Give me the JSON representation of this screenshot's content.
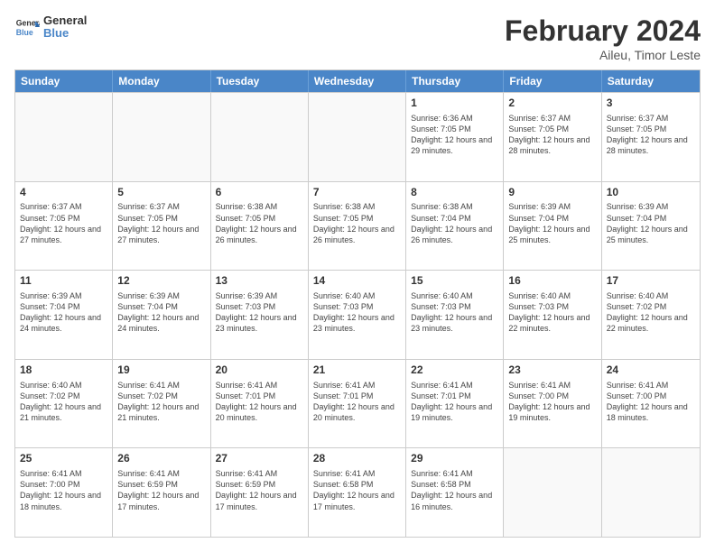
{
  "logo": {
    "general": "General",
    "blue": "Blue"
  },
  "header": {
    "title": "February 2024",
    "subtitle": "Aileu, Timor Leste"
  },
  "weekdays": [
    "Sunday",
    "Monday",
    "Tuesday",
    "Wednesday",
    "Thursday",
    "Friday",
    "Saturday"
  ],
  "weeks": [
    [
      {
        "day": "",
        "info": "",
        "empty": true
      },
      {
        "day": "",
        "info": "",
        "empty": true
      },
      {
        "day": "",
        "info": "",
        "empty": true
      },
      {
        "day": "",
        "info": "",
        "empty": true
      },
      {
        "day": "1",
        "info": "Sunrise: 6:36 AM\nSunset: 7:05 PM\nDaylight: 12 hours and 29 minutes."
      },
      {
        "day": "2",
        "info": "Sunrise: 6:37 AM\nSunset: 7:05 PM\nDaylight: 12 hours and 28 minutes."
      },
      {
        "day": "3",
        "info": "Sunrise: 6:37 AM\nSunset: 7:05 PM\nDaylight: 12 hours and 28 minutes."
      }
    ],
    [
      {
        "day": "4",
        "info": "Sunrise: 6:37 AM\nSunset: 7:05 PM\nDaylight: 12 hours and 27 minutes."
      },
      {
        "day": "5",
        "info": "Sunrise: 6:37 AM\nSunset: 7:05 PM\nDaylight: 12 hours and 27 minutes."
      },
      {
        "day": "6",
        "info": "Sunrise: 6:38 AM\nSunset: 7:05 PM\nDaylight: 12 hours and 26 minutes."
      },
      {
        "day": "7",
        "info": "Sunrise: 6:38 AM\nSunset: 7:05 PM\nDaylight: 12 hours and 26 minutes."
      },
      {
        "day": "8",
        "info": "Sunrise: 6:38 AM\nSunset: 7:04 PM\nDaylight: 12 hours and 26 minutes."
      },
      {
        "day": "9",
        "info": "Sunrise: 6:39 AM\nSunset: 7:04 PM\nDaylight: 12 hours and 25 minutes."
      },
      {
        "day": "10",
        "info": "Sunrise: 6:39 AM\nSunset: 7:04 PM\nDaylight: 12 hours and 25 minutes."
      }
    ],
    [
      {
        "day": "11",
        "info": "Sunrise: 6:39 AM\nSunset: 7:04 PM\nDaylight: 12 hours and 24 minutes."
      },
      {
        "day": "12",
        "info": "Sunrise: 6:39 AM\nSunset: 7:04 PM\nDaylight: 12 hours and 24 minutes."
      },
      {
        "day": "13",
        "info": "Sunrise: 6:39 AM\nSunset: 7:03 PM\nDaylight: 12 hours and 23 minutes."
      },
      {
        "day": "14",
        "info": "Sunrise: 6:40 AM\nSunset: 7:03 PM\nDaylight: 12 hours and 23 minutes."
      },
      {
        "day": "15",
        "info": "Sunrise: 6:40 AM\nSunset: 7:03 PM\nDaylight: 12 hours and 23 minutes."
      },
      {
        "day": "16",
        "info": "Sunrise: 6:40 AM\nSunset: 7:03 PM\nDaylight: 12 hours and 22 minutes."
      },
      {
        "day": "17",
        "info": "Sunrise: 6:40 AM\nSunset: 7:02 PM\nDaylight: 12 hours and 22 minutes."
      }
    ],
    [
      {
        "day": "18",
        "info": "Sunrise: 6:40 AM\nSunset: 7:02 PM\nDaylight: 12 hours and 21 minutes."
      },
      {
        "day": "19",
        "info": "Sunrise: 6:41 AM\nSunset: 7:02 PM\nDaylight: 12 hours and 21 minutes."
      },
      {
        "day": "20",
        "info": "Sunrise: 6:41 AM\nSunset: 7:01 PM\nDaylight: 12 hours and 20 minutes."
      },
      {
        "day": "21",
        "info": "Sunrise: 6:41 AM\nSunset: 7:01 PM\nDaylight: 12 hours and 20 minutes."
      },
      {
        "day": "22",
        "info": "Sunrise: 6:41 AM\nSunset: 7:01 PM\nDaylight: 12 hours and 19 minutes."
      },
      {
        "day": "23",
        "info": "Sunrise: 6:41 AM\nSunset: 7:00 PM\nDaylight: 12 hours and 19 minutes."
      },
      {
        "day": "24",
        "info": "Sunrise: 6:41 AM\nSunset: 7:00 PM\nDaylight: 12 hours and 18 minutes."
      }
    ],
    [
      {
        "day": "25",
        "info": "Sunrise: 6:41 AM\nSunset: 7:00 PM\nDaylight: 12 hours and 18 minutes."
      },
      {
        "day": "26",
        "info": "Sunrise: 6:41 AM\nSunset: 6:59 PM\nDaylight: 12 hours and 17 minutes."
      },
      {
        "day": "27",
        "info": "Sunrise: 6:41 AM\nSunset: 6:59 PM\nDaylight: 12 hours and 17 minutes."
      },
      {
        "day": "28",
        "info": "Sunrise: 6:41 AM\nSunset: 6:58 PM\nDaylight: 12 hours and 17 minutes."
      },
      {
        "day": "29",
        "info": "Sunrise: 6:41 AM\nSunset: 6:58 PM\nDaylight: 12 hours and 16 minutes."
      },
      {
        "day": "",
        "info": "",
        "empty": true
      },
      {
        "day": "",
        "info": "",
        "empty": true
      }
    ]
  ]
}
